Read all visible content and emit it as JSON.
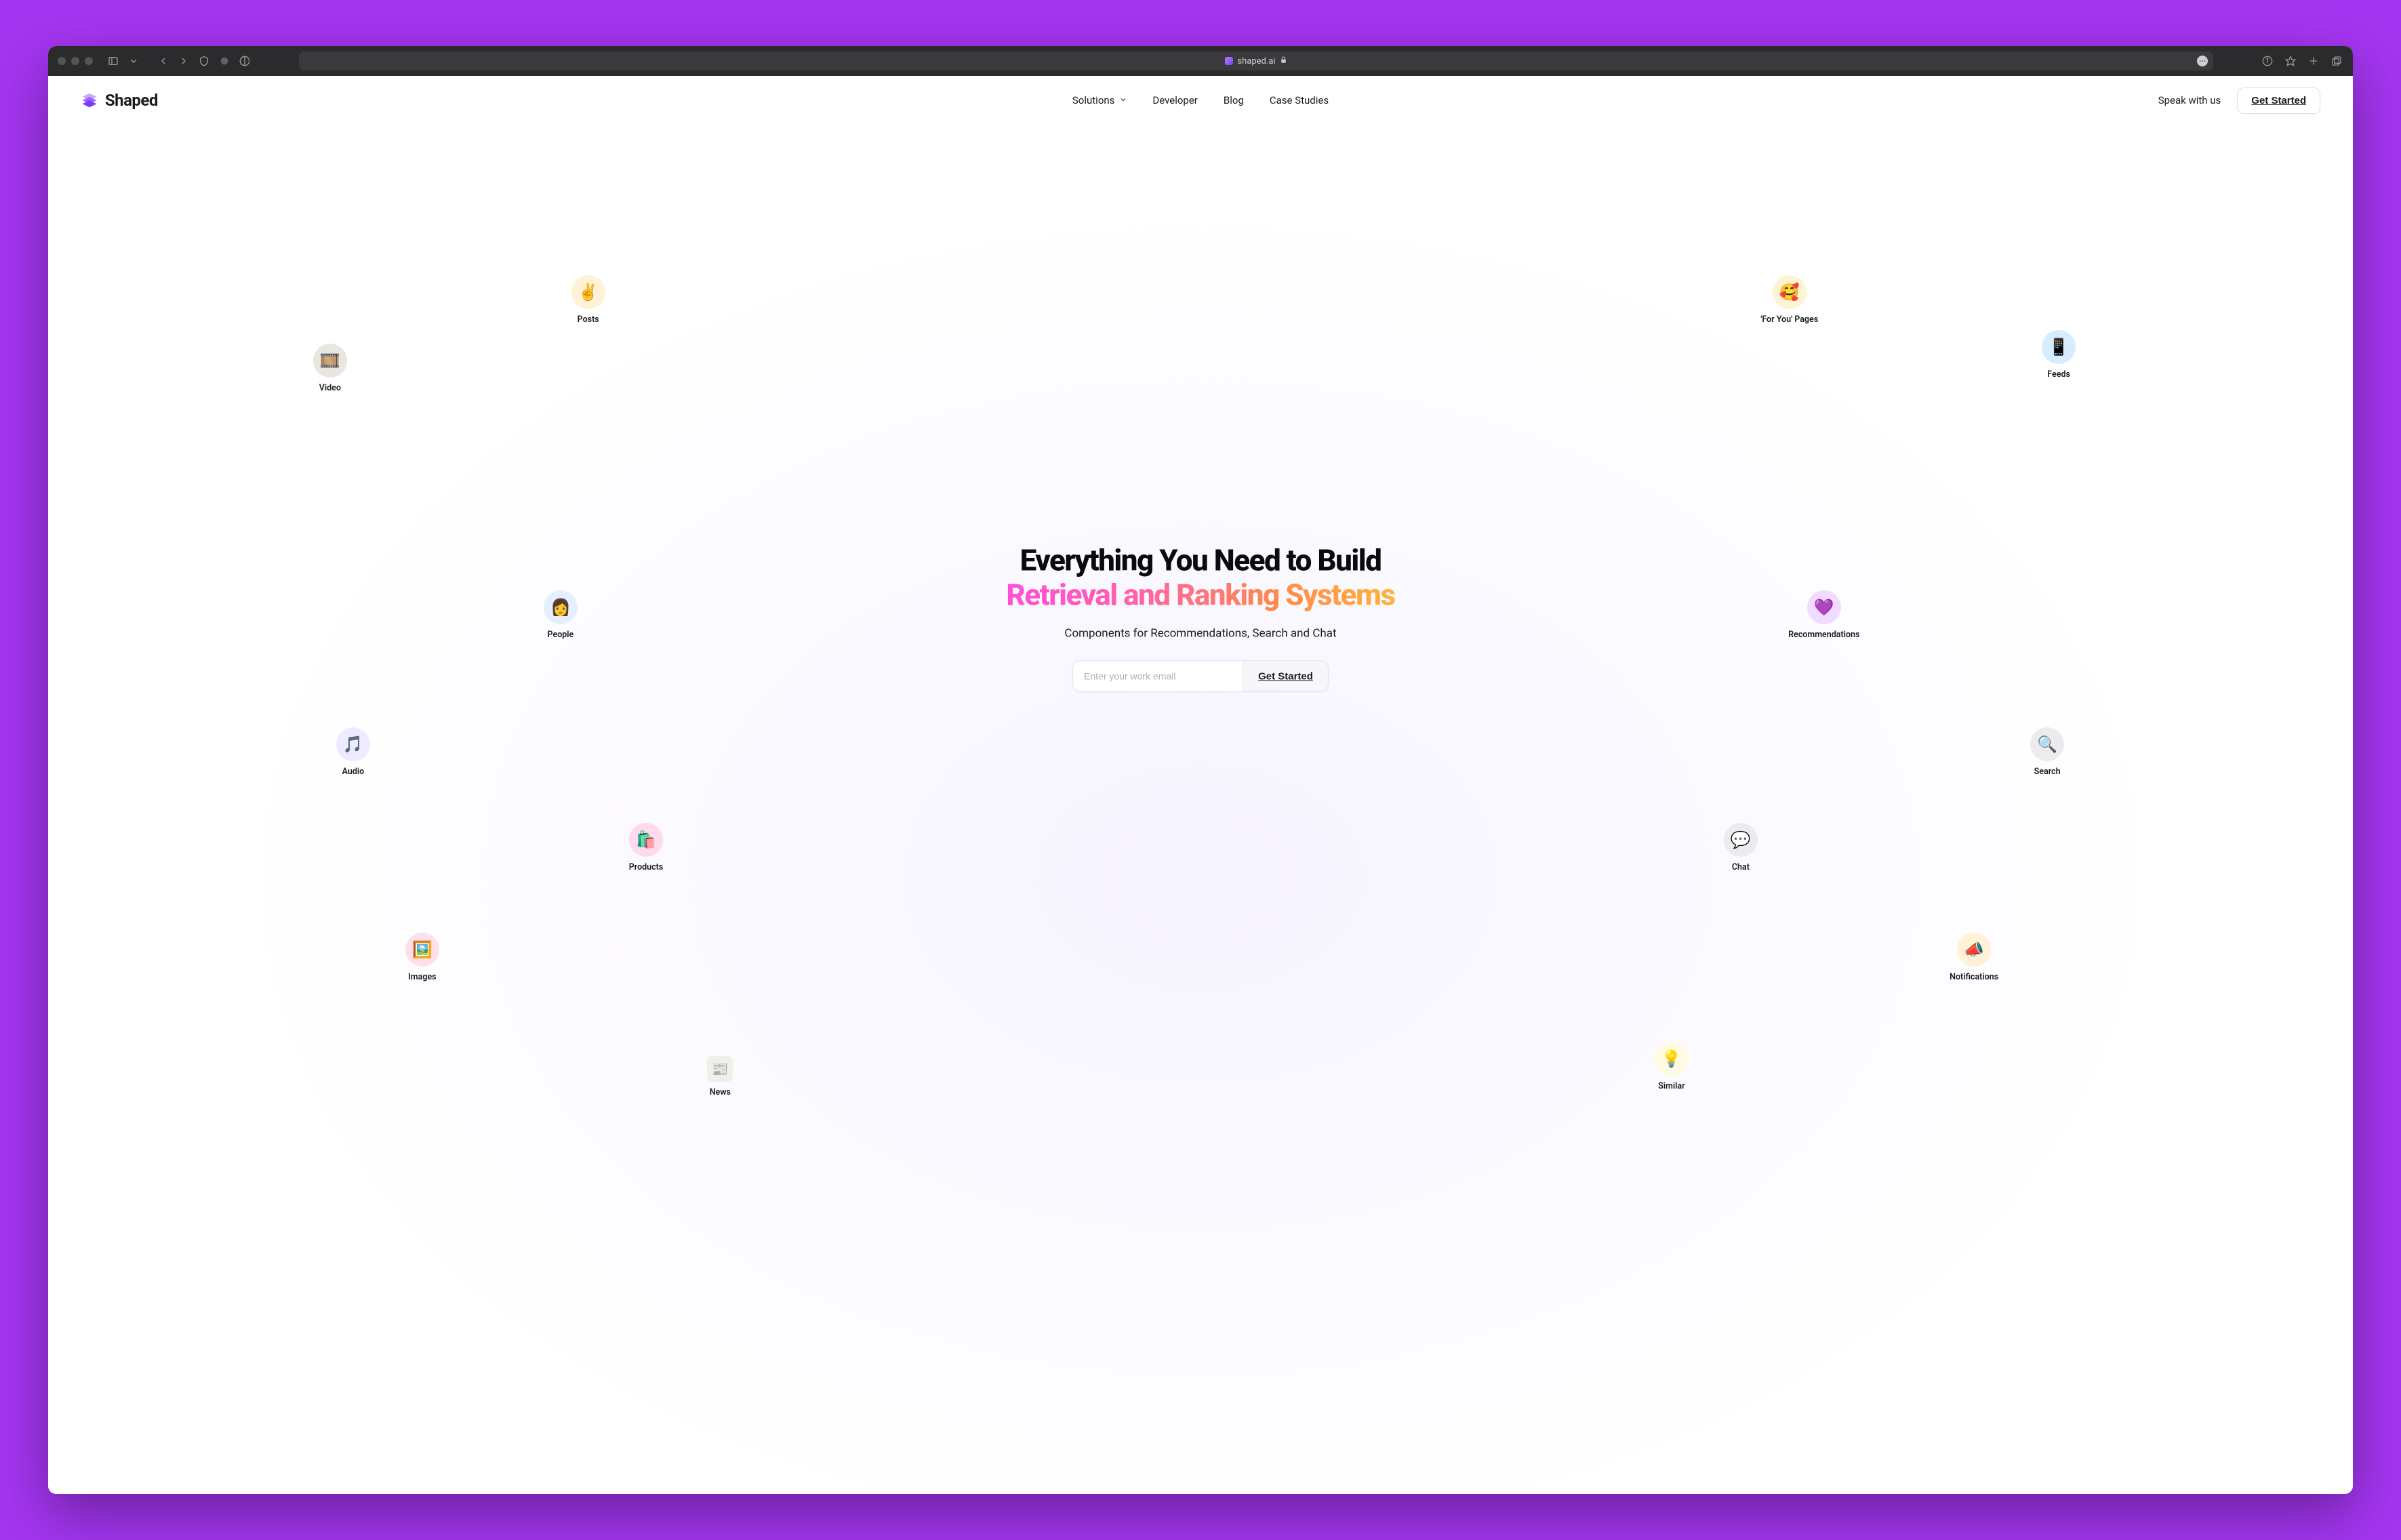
{
  "browser": {
    "url": "shaped.ai"
  },
  "nav": {
    "brand": "Shaped",
    "links": {
      "solutions": "Solutions",
      "developer": "Developer",
      "blog": "Blog",
      "case_studies": "Case Studies"
    },
    "speak": "Speak with us",
    "get_started": "Get Started"
  },
  "hero": {
    "headline_top": "Everything You Need to Build",
    "headline_grad": "Retrieval and Ranking Systems",
    "sub": "Components for Recommendations, Search and Chat",
    "email_placeholder": "Enter your work email",
    "cta": "Get Started"
  },
  "chips": {
    "video": "Video",
    "posts": "Posts",
    "people": "People",
    "audio": "Audio",
    "products": "Products",
    "images": "Images",
    "news": "News",
    "foryou": "'For You' Pages",
    "feeds": "Feeds",
    "recs": "Recommendations",
    "search": "Search",
    "chat": "Chat",
    "notif": "Notifications",
    "similar": "Similar"
  }
}
